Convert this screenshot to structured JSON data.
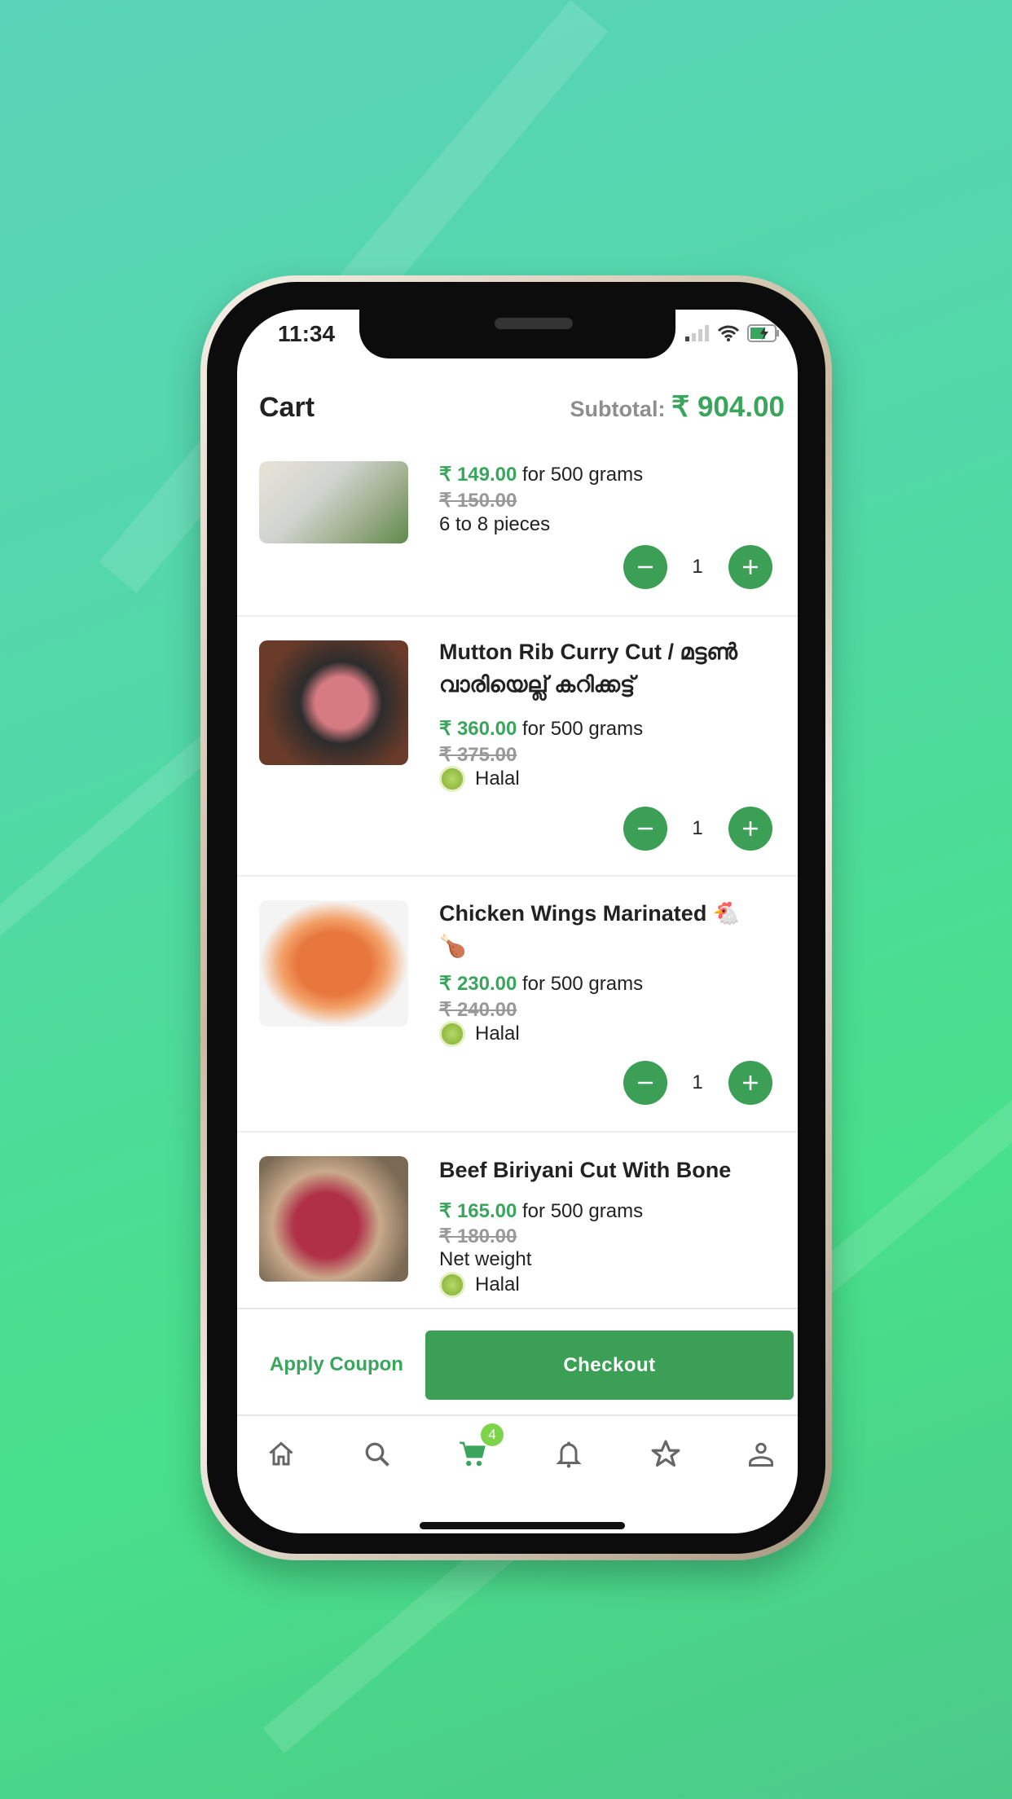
{
  "status_bar": {
    "time": "11:34"
  },
  "header": {
    "title": "Cart",
    "subtotal_label": "Subtotal:",
    "subtotal_value": "₹ 904.00"
  },
  "items": [
    {
      "title": "",
      "price": "₹ 149.00",
      "unit": "for 500 grams",
      "old_price": "₹ 150.00",
      "note": "6 to 8 pieces",
      "halal": "",
      "qty": "1"
    },
    {
      "title": "Mutton Rib Curry Cut / മട്ടൺ വാരിയെല്ല് കറിക്കട്ട്",
      "price": "₹ 360.00",
      "unit": "for 500 grams",
      "old_price": "₹ 375.00",
      "note": "",
      "halal": "Halal",
      "qty": "1"
    },
    {
      "title": "Chicken Wings Marinated 🐔🍗",
      "price": "₹ 230.00",
      "unit": "for 500 grams",
      "old_price": "₹ 240.00",
      "note": "",
      "halal": "Halal",
      "qty": "1"
    },
    {
      "title": "Beef Biriyani Cut With Bone",
      "price": "₹ 165.00",
      "unit": "for 500 grams",
      "old_price": "₹ 180.00",
      "note": "Net weight",
      "halal": "Halal",
      "qty": ""
    }
  ],
  "footer": {
    "apply_coupon": "Apply Coupon",
    "checkout": "Checkout"
  },
  "nav": {
    "items": [
      "home-icon",
      "search-icon",
      "cart-icon",
      "bell-icon",
      "star-icon",
      "user-icon"
    ],
    "active": "cart-icon",
    "cart_count": "4"
  },
  "colors": {
    "accent": "#3aa55c",
    "button": "#3c9f56",
    "badge": "#7dd34a"
  }
}
